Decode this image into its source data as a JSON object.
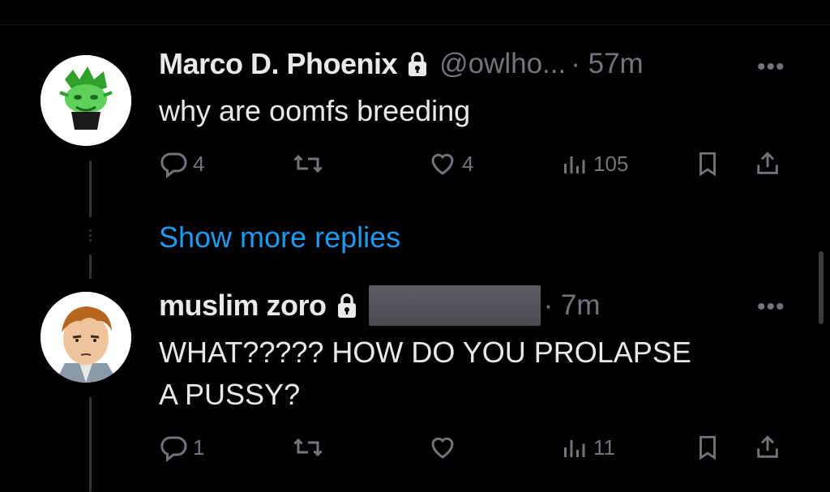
{
  "tweet1": {
    "name": "Marco D. Phoenix",
    "handle": "@owlho...",
    "time": "· 57m",
    "text": "why are oomfs breeding",
    "replies": "4",
    "likes": "4",
    "views": "105"
  },
  "show_more": "Show more replies",
  "tweet2": {
    "name": "muslim zoro",
    "time": "· 7m",
    "text_line1": "WHAT????? HOW DO YOU PROLAPSE",
    "text_line2": "A PUSSY?",
    "replies": "1",
    "views": "11"
  },
  "colors": {
    "background": "#000000",
    "text": "#e7e9ea",
    "muted": "#71767b",
    "link": "#1d9bf0"
  },
  "icons": [
    "lock-icon",
    "more-icon",
    "reply-icon",
    "retweet-icon",
    "like-icon",
    "views-icon",
    "bookmark-icon",
    "share-icon"
  ]
}
